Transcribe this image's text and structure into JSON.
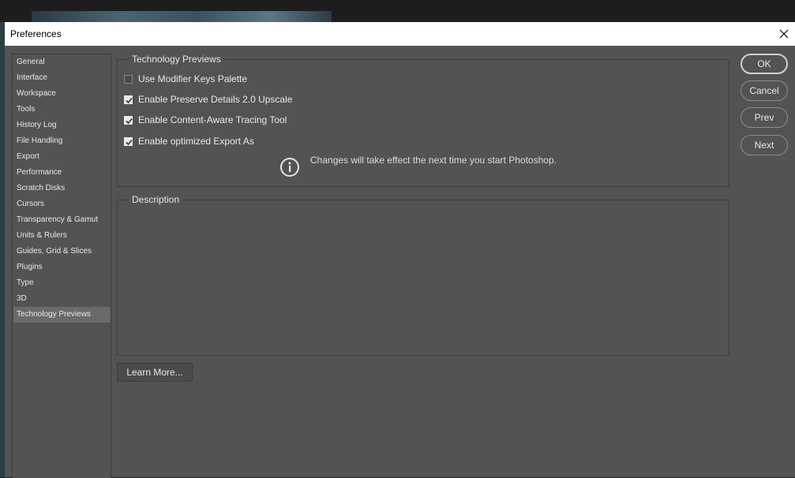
{
  "window": {
    "title": "Preferences"
  },
  "sidebar": {
    "items": [
      {
        "label": "General"
      },
      {
        "label": "Interface"
      },
      {
        "label": "Workspace"
      },
      {
        "label": "Tools"
      },
      {
        "label": "History Log"
      },
      {
        "label": "File Handling"
      },
      {
        "label": "Export"
      },
      {
        "label": "Performance"
      },
      {
        "label": "Scratch Disks"
      },
      {
        "label": "Cursors"
      },
      {
        "label": "Transparency & Gamut"
      },
      {
        "label": "Units & Rulers"
      },
      {
        "label": "Guides, Grid & Slices"
      },
      {
        "label": "Plugins"
      },
      {
        "label": "Type"
      },
      {
        "label": "3D"
      },
      {
        "label": "Technology Previews",
        "selected": true
      }
    ]
  },
  "technology_previews": {
    "legend": "Technology Previews",
    "options": [
      {
        "label": "Use Modifier Keys Palette",
        "checked": false
      },
      {
        "label": "Enable Preserve Details 2.0 Upscale",
        "checked": true
      },
      {
        "label": "Enable Content-Aware Tracing Tool",
        "checked": true
      },
      {
        "label": "Enable optimized Export As",
        "checked": true
      }
    ],
    "info_text": "Changes will take effect the next time you start Photoshop."
  },
  "description": {
    "legend": "Description"
  },
  "buttons": {
    "ok": "OK",
    "cancel": "Cancel",
    "prev": "Prev",
    "next": "Next",
    "learn_more": "Learn More..."
  },
  "icons": {
    "close": "close-icon",
    "info": "info-icon",
    "check": "checkmark-icon"
  },
  "colors": {
    "dialog_bg": "#535353",
    "selected_item_bg": "#6a6a6a",
    "text": "#e8e8e8"
  }
}
